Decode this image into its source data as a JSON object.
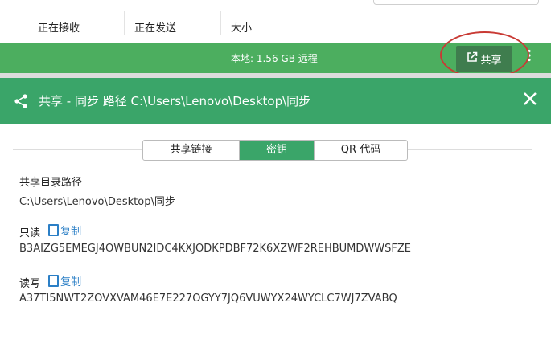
{
  "header": {
    "columns": [
      "正在接收",
      "正在发送",
      "大小"
    ]
  },
  "status_bar": {
    "text": "本地: 1.56 GB 远程",
    "share_button": "共享",
    "more_icon": "more-vertical-icon",
    "color": "#4cae5f"
  },
  "dialog": {
    "title": "共享 - 同步 路径 C:\\Users\\Lenovo\\Desktop\\同步",
    "header_color": "#3aa569",
    "tabs": [
      {
        "label": "共享链接",
        "active": false
      },
      {
        "label": "密钥",
        "active": true
      },
      {
        "label": "QR 代码",
        "active": false
      }
    ],
    "path_label": "共享目录路径",
    "path_value": "C:\\Users\\Lenovo\\Desktop\\同步",
    "readonly_label": "只读",
    "readonly_copy": "复制",
    "readonly_key": "B3AIZG5EMEGJ4OWBUN2IDC4KXJODKPDBF72K6XZWF2REHBUMDWWSFZE",
    "readwrite_label": "读写",
    "readwrite_copy": "复制",
    "readwrite_key": "A37TI5NWT2ZOVXVAM46E7E227OGYY7JQ6VUWYX24WYCLC7WJ7ZVABQ"
  }
}
